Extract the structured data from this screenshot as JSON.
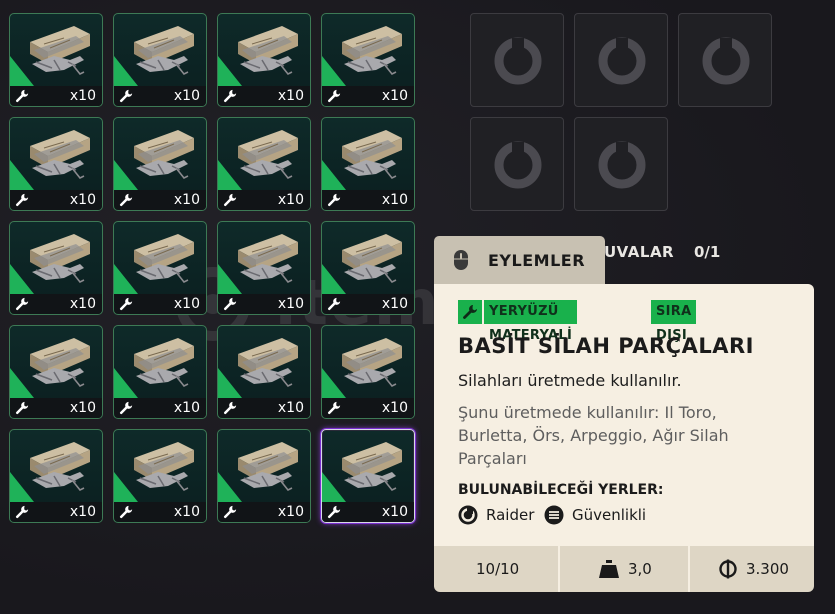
{
  "inventory": {
    "quantity_label": "x10",
    "item_count": 20,
    "item_icon": "weapon-parts-crate-icon",
    "slot_icon": "wrench-icon",
    "rarity_color": "#1fb259"
  },
  "attachments": {
    "empty_slot_icon": "empty-slot-ring-icon",
    "slots_label": "UVALAR",
    "slots_count": "0/1"
  },
  "tooltip": {
    "actions_label": "EYLEMLER",
    "actions_icon": "mouse-icon",
    "tags": [
      "YERYÜZÜ MATERYALİ",
      "SIRA DIŞI"
    ],
    "tag_icon": "wrench-icon",
    "tag_color": "#19b14c",
    "title": "BASİT SİLAH PARÇALARI",
    "description": "Silahları üretmede kullanılır.",
    "used_in": "Şunu üretmede kullanılır: Il Toro, Burletta, Örs, Arpeggio, Ağır Silah Parçaları",
    "found_header": "BULUNABİLECEĞİ YERLER:",
    "sources": [
      {
        "icon": "raider-icon",
        "label": "Raider"
      },
      {
        "icon": "security-icon",
        "label": "Güvenlikli"
      }
    ],
    "stack": "10/10",
    "weight_icon": "weight-icon",
    "weight": "3,0",
    "value_icon": "coin-icon",
    "value": "3.300"
  },
  "watermark": "itemvalue"
}
